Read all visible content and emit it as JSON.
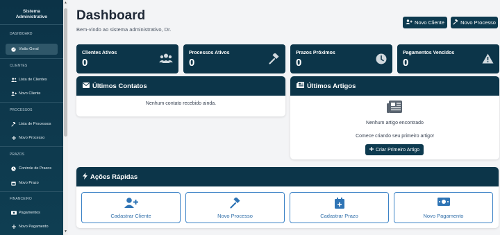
{
  "sidebar": {
    "brand_line1": "Sistema",
    "brand_line2": "Administrativo",
    "sections": {
      "dashboard": "DASHBOARD",
      "clientes": "CLIENTES",
      "processos": "PROCESSOS",
      "prazos": "PRAZOS",
      "financeiro": "FINANCEIRO"
    },
    "items": {
      "visao_geral": "Visão Geral",
      "lista_clientes": "Lista de Clientes",
      "novo_cliente": "Novo Cliente",
      "lista_processos": "Lista de Processos",
      "novo_processo": "Novo Processo",
      "controle_prazos": "Controle de Prazos",
      "novo_prazo": "Novo Prazo",
      "pagamentos": "Pagamentos",
      "novo_pagamento": "Novo Pagamento"
    }
  },
  "header": {
    "title": "Dashboard",
    "subtitle": "Bem-vindo ao sistema administrativo, Dr.",
    "btn_novo_cliente": "Novo Cliente",
    "btn_novo_processo": "Novo Processo"
  },
  "stats": {
    "clientes": {
      "label": "Clientes Ativos",
      "value": "0",
      "icon": "users-icon"
    },
    "processos": {
      "label": "Processos Ativos",
      "value": "0",
      "icon": "gavel-icon"
    },
    "prazos": {
      "label": "Prazos Próximos",
      "value": "0",
      "icon": "clock-icon"
    },
    "pagamentos": {
      "label": "Pagamentos Vencidos",
      "value": "0",
      "icon": "warning-icon"
    }
  },
  "contatos": {
    "title": "Últimos Contatos",
    "empty": "Nenhum contato recebido ainda."
  },
  "artigos": {
    "title": "Últimos Artigos",
    "empty": "Nenhum artigo encontrado",
    "hint": "Comece criando seu primeiro artigo!",
    "button": "Criar Primeiro Artigo"
  },
  "acoes": {
    "title": "Ações Rápidas",
    "cadastrar_cliente": "Cadastrar Cliente",
    "novo_processo": "Novo Processo",
    "cadastrar_prazo": "Cadastrar Prazo",
    "novo_pagamento": "Novo Pagamento"
  },
  "colors": {
    "primary": "#0c3549",
    "accent": "#3b82c6",
    "background": "#f3f4f6"
  }
}
